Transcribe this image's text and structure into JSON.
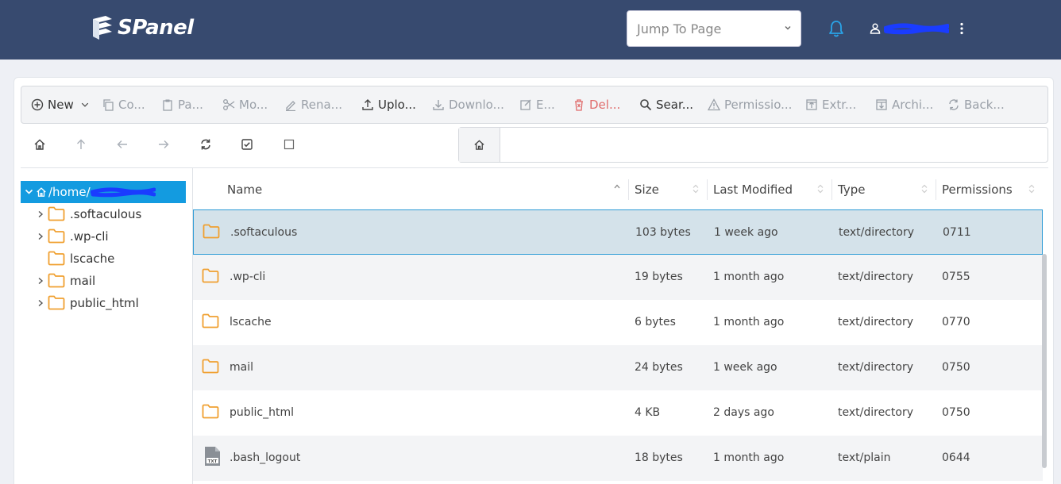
{
  "brand": {
    "name": "SPanel"
  },
  "header": {
    "jump_placeholder": "Jump To Page"
  },
  "toolbar": [
    {
      "label": "New",
      "icon": "plus-circle-icon",
      "state": "active"
    },
    {
      "label": "Co...",
      "icon": "copy-icon",
      "state": "disabled"
    },
    {
      "label": "Pa...",
      "icon": "clipboard-icon",
      "state": "disabled"
    },
    {
      "label": "Mo...",
      "icon": "scissors-icon",
      "state": "disabled"
    },
    {
      "label": "Rena...",
      "icon": "pen-icon",
      "state": "disabled"
    },
    {
      "label": "Uplo...",
      "icon": "upload-icon",
      "state": "active"
    },
    {
      "label": "Downlo...",
      "icon": "download-icon",
      "state": "disabled"
    },
    {
      "label": "E...",
      "icon": "edit-icon",
      "state": "disabled"
    },
    {
      "label": "Del...",
      "icon": "trash-icon",
      "state": "danger"
    },
    {
      "label": "Sear...",
      "icon": "search-icon",
      "state": "active"
    },
    {
      "label": "Permissio...",
      "icon": "warning-icon",
      "state": "disabled"
    },
    {
      "label": "Extr...",
      "icon": "extract-icon",
      "state": "disabled"
    },
    {
      "label": "Archi...",
      "icon": "archive-icon",
      "state": "disabled"
    },
    {
      "label": "Back...",
      "icon": "backup-icon",
      "state": "disabled"
    }
  ],
  "tree": {
    "root_label": "/home/",
    "items": [
      {
        "label": ".softaculous",
        "expandable": true
      },
      {
        "label": ".wp-cli",
        "expandable": true
      },
      {
        "label": "lscache",
        "expandable": false
      },
      {
        "label": "mail",
        "expandable": true
      },
      {
        "label": "public_html",
        "expandable": true
      }
    ]
  },
  "table": {
    "columns": [
      "Name",
      "Size",
      "Last Modified",
      "Type",
      "Permissions"
    ],
    "rows": [
      {
        "name": ".softaculous",
        "size": "103 bytes",
        "modified": "1 week ago",
        "type": "text/directory",
        "perms": "0711",
        "kind": "folder",
        "selected": true
      },
      {
        "name": ".wp-cli",
        "size": "19 bytes",
        "modified": "1 month ago",
        "type": "text/directory",
        "perms": "0755",
        "kind": "folder"
      },
      {
        "name": "lscache",
        "size": "6 bytes",
        "modified": "1 month ago",
        "type": "text/directory",
        "perms": "0770",
        "kind": "folder"
      },
      {
        "name": "mail",
        "size": "24 bytes",
        "modified": "1 week ago",
        "type": "text/directory",
        "perms": "0750",
        "kind": "folder"
      },
      {
        "name": "public_html",
        "size": "4 KB",
        "modified": "2 days ago",
        "type": "text/directory",
        "perms": "0750",
        "kind": "folder"
      },
      {
        "name": ".bash_logout",
        "size": "18 bytes",
        "modified": "1 month ago",
        "type": "text/plain",
        "perms": "0644",
        "kind": "text"
      }
    ]
  },
  "colors": {
    "header_bg": "#374a6f",
    "accent": "#139be0",
    "folder": "#f0a030",
    "danger": "#e06b6b"
  }
}
